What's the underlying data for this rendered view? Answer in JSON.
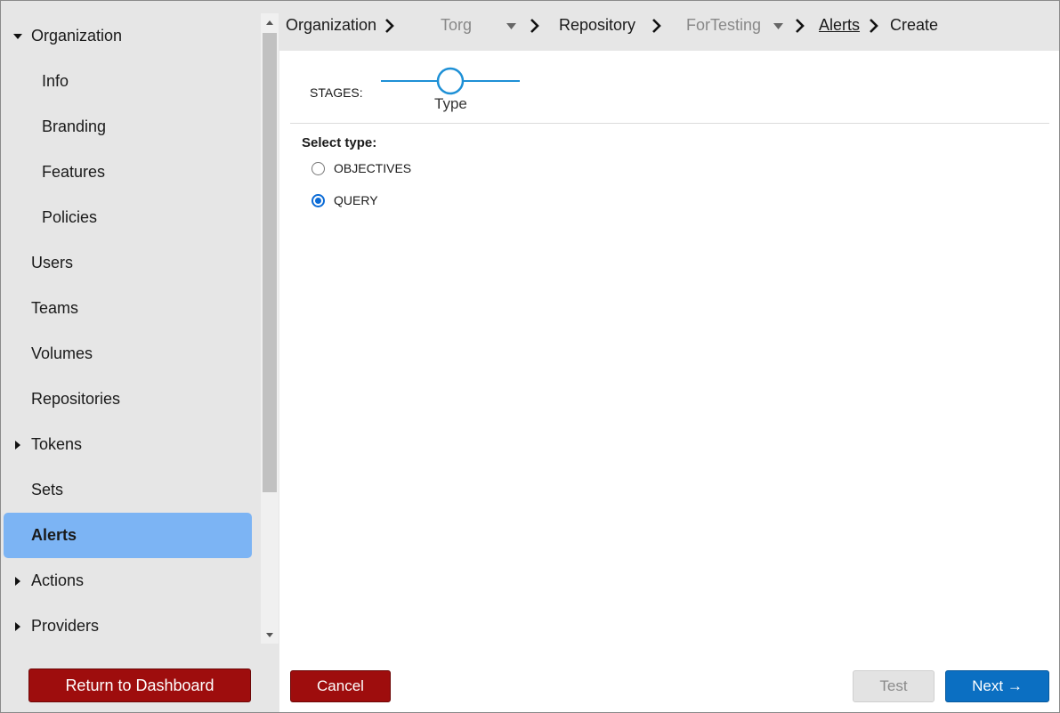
{
  "sidebar": {
    "items": [
      {
        "label": "Organization",
        "expander": "expanded",
        "sub": false,
        "active": false
      },
      {
        "label": "Info",
        "expander": "none",
        "sub": true,
        "active": false
      },
      {
        "label": "Branding",
        "expander": "none",
        "sub": true,
        "active": false
      },
      {
        "label": "Features",
        "expander": "none",
        "sub": true,
        "active": false
      },
      {
        "label": "Policies",
        "expander": "none",
        "sub": true,
        "active": false
      },
      {
        "label": "Users",
        "expander": "none",
        "sub": false,
        "active": false
      },
      {
        "label": "Teams",
        "expander": "none",
        "sub": false,
        "active": false
      },
      {
        "label": "Volumes",
        "expander": "none",
        "sub": false,
        "active": false
      },
      {
        "label": "Repositories",
        "expander": "none",
        "sub": false,
        "active": false
      },
      {
        "label": "Tokens",
        "expander": "collapsed",
        "sub": false,
        "active": false
      },
      {
        "label": "Sets",
        "expander": "none",
        "sub": false,
        "active": false
      },
      {
        "label": "Alerts",
        "expander": "none",
        "sub": false,
        "active": true
      },
      {
        "label": "Actions",
        "expander": "collapsed",
        "sub": false,
        "active": false
      },
      {
        "label": "Providers",
        "expander": "collapsed",
        "sub": false,
        "active": false
      }
    ],
    "return_label": "Return to Dashboard"
  },
  "breadcrumb": {
    "organization": "Organization",
    "org_select": "Torg",
    "repository": "Repository",
    "repo_select": "ForTesting",
    "alerts": "Alerts",
    "create": "Create"
  },
  "stages": {
    "label": "STAGES:",
    "current": "Type"
  },
  "form": {
    "select_label": "Select type:",
    "options": [
      {
        "label": "OBJECTIVES",
        "checked": false
      },
      {
        "label": "QUERY",
        "checked": true
      }
    ]
  },
  "footer": {
    "cancel_label": "Cancel",
    "test_label": "Test",
    "next_label": "Next →"
  },
  "colors": {
    "accent_blue": "#0b6fc2",
    "danger_red": "#9e0d0d",
    "active_nav": "#7cb4f4",
    "stage_line": "#1e90d6"
  }
}
